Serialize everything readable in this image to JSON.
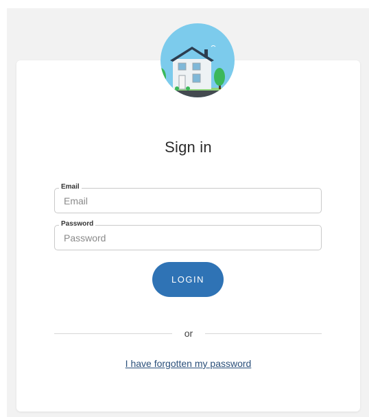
{
  "title": "Sign in",
  "email": {
    "label": "Email",
    "placeholder": "Email",
    "value": ""
  },
  "password": {
    "label": "Password",
    "placeholder": "Password",
    "value": ""
  },
  "login_label": "LOGIN",
  "divider_text": "or",
  "forgot_link": "I have forgotten my password",
  "logo_icon": "house-icon",
  "colors": {
    "page_bg": "#f2f2f2",
    "card_bg": "#ffffff",
    "primary": "#2f73b5",
    "link": "#2a4f7a",
    "logo_sky": "#7ccbec",
    "tree": "#3bb85a",
    "house_roof": "#2c3e50"
  }
}
